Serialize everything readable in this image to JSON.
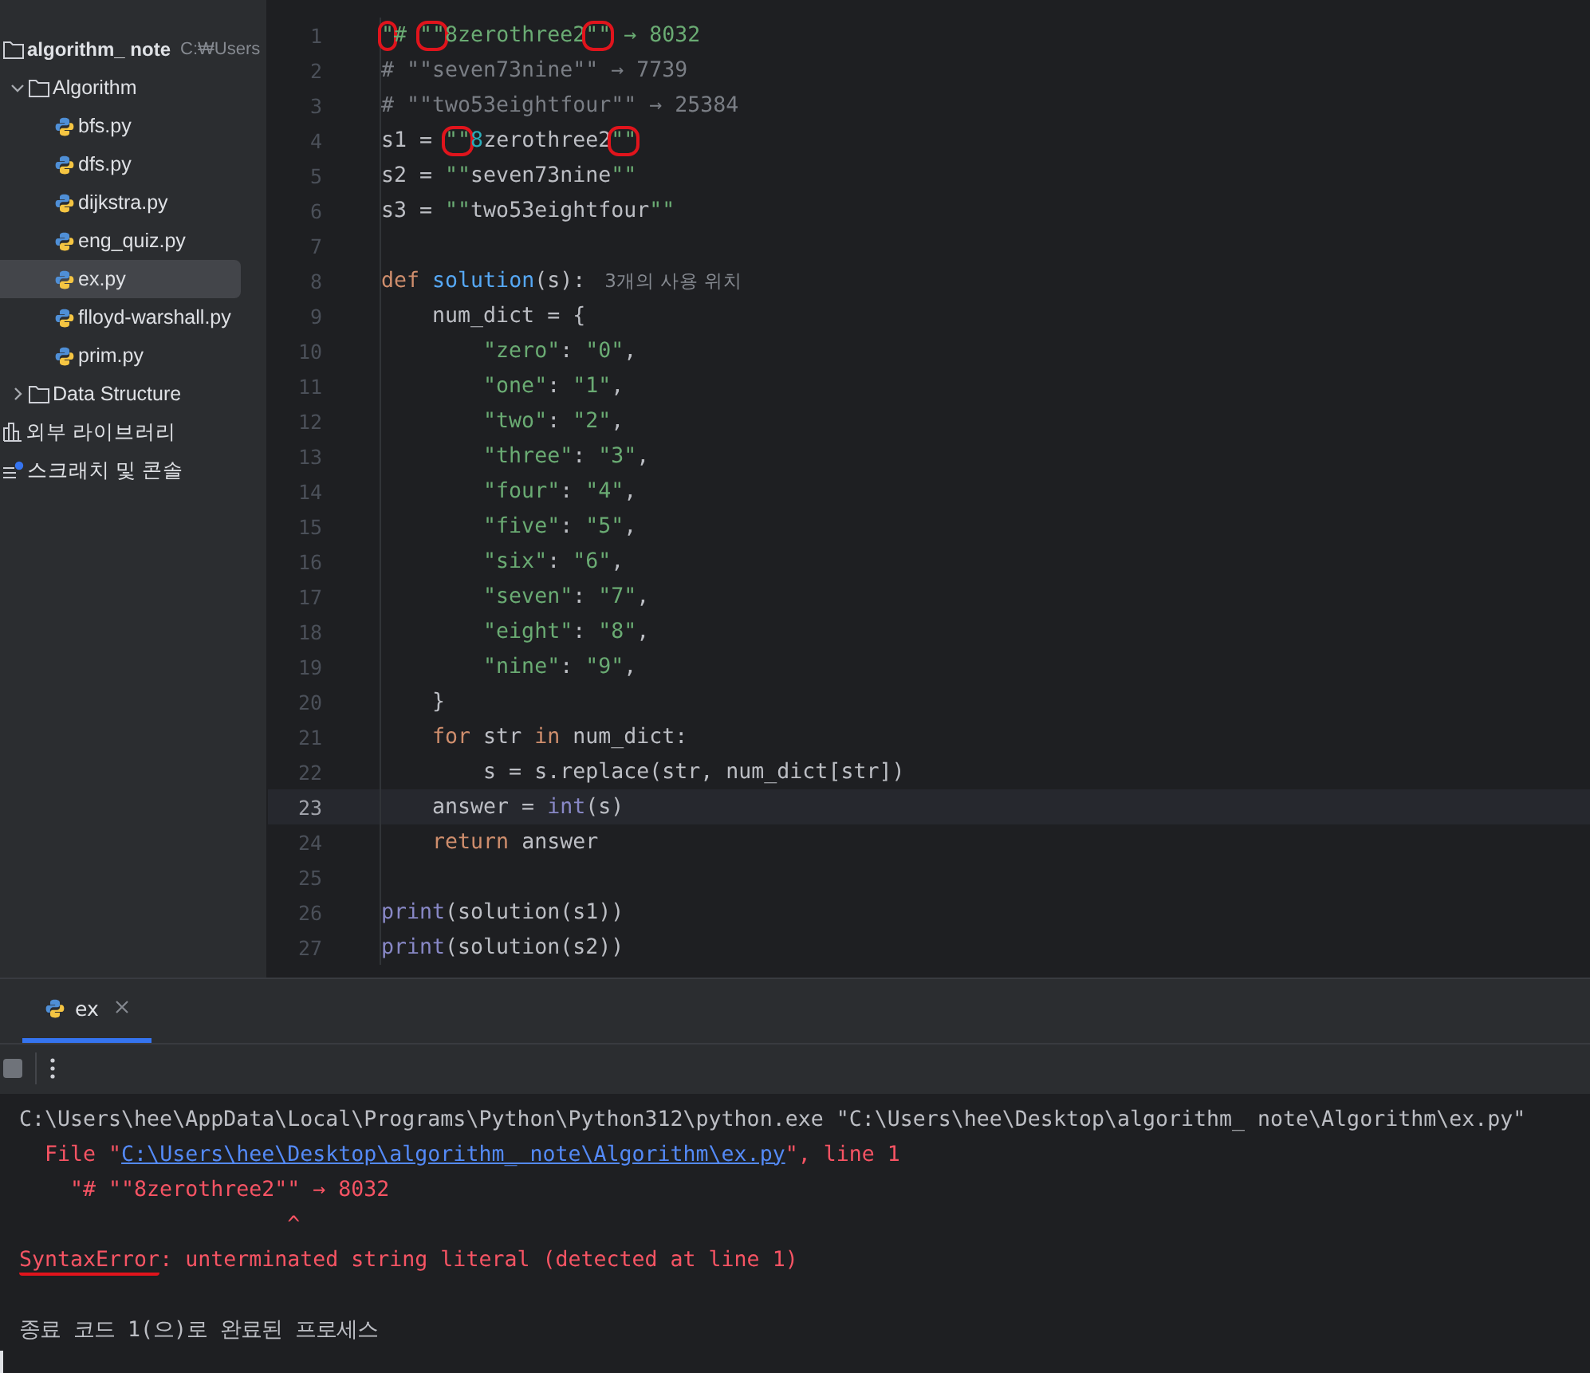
{
  "project_tree": [
    {
      "kind": "project",
      "label": "algorithm_ note",
      "hint": "C:₩Users",
      "selected": false
    },
    {
      "kind": "folder",
      "label": "Algorithm",
      "expanded": true,
      "selected": false,
      "children": [
        {
          "kind": "file",
          "label": "bfs.py",
          "selected": false
        },
        {
          "kind": "file",
          "label": "dfs.py",
          "selected": false
        },
        {
          "kind": "file",
          "label": "dijkstra.py",
          "selected": false
        },
        {
          "kind": "file",
          "label": "eng_quiz.py",
          "selected": false
        },
        {
          "kind": "file",
          "label": "ex.py",
          "selected": true
        },
        {
          "kind": "file",
          "label": "flloyd-warshall.py",
          "selected": false
        },
        {
          "kind": "file",
          "label": "prim.py",
          "selected": false
        }
      ]
    },
    {
      "kind": "folder",
      "label": "Data Structure",
      "expanded": false,
      "selected": false
    },
    {
      "kind": "library",
      "label": "외부 라이브러리",
      "selected": false
    },
    {
      "kind": "scratch",
      "label": "스크래치 및 콘솔",
      "selected": false
    }
  ],
  "editor": {
    "lines": [
      {
        "number": "1",
        "current": false,
        "tokens": [
          {
            "kind": "string",
            "text": "\"",
            "circled": true
          },
          {
            "kind": "string",
            "text": "# "
          },
          {
            "kind": "string",
            "text": "\"\"",
            "circled": true
          },
          {
            "kind": "string",
            "text": "8zerothree2"
          },
          {
            "kind": "string",
            "text": "\"\"",
            "circled": true
          },
          {
            "kind": "string",
            "text": " → 8032"
          }
        ]
      },
      {
        "number": "2",
        "current": false,
        "tokens": [
          {
            "kind": "comment",
            "text": "# \"\"seven73nine\"\" → 7739"
          }
        ]
      },
      {
        "number": "3",
        "current": false,
        "tokens": [
          {
            "kind": "comment",
            "text": "# \"\"two53eightfour\"\" → 25384"
          }
        ]
      },
      {
        "number": "4",
        "current": false,
        "tokens": [
          {
            "kind": "plain",
            "text": "s1 = "
          },
          {
            "kind": "string",
            "text": "\"\"",
            "circled": true
          },
          {
            "kind": "number",
            "text": "8"
          },
          {
            "kind": "plain",
            "text": "zerothree2"
          },
          {
            "kind": "string",
            "text": "\"\"",
            "circled": true
          }
        ]
      },
      {
        "number": "5",
        "current": false,
        "tokens": [
          {
            "kind": "plain",
            "text": "s2 = "
          },
          {
            "kind": "string",
            "text": "\"\""
          },
          {
            "kind": "plain",
            "text": "seven73nine"
          },
          {
            "kind": "string",
            "text": "\"\""
          }
        ]
      },
      {
        "number": "6",
        "current": false,
        "tokens": [
          {
            "kind": "plain",
            "text": "s3 = "
          },
          {
            "kind": "string",
            "text": "\"\""
          },
          {
            "kind": "plain",
            "text": "two53eightfour"
          },
          {
            "kind": "string",
            "text": "\"\""
          }
        ]
      },
      {
        "number": "7",
        "current": false
      },
      {
        "number": "8",
        "current": false,
        "tokens": [
          {
            "kind": "keyword",
            "text": "def "
          },
          {
            "kind": "function",
            "text": "solution"
          },
          {
            "kind": "plain",
            "text": "(s):"
          },
          {
            "kind": "hint",
            "text": "3개의 사용 위치"
          }
        ]
      },
      {
        "number": "9",
        "current": false,
        "tokens": [
          {
            "kind": "plain",
            "text": "    num_dict = {"
          }
        ]
      },
      {
        "number": "10",
        "current": false,
        "tokens": [
          {
            "kind": "string",
            "text": "        \"zero\""
          },
          {
            "kind": "plain",
            "text": ": "
          },
          {
            "kind": "string",
            "text": "\"0\""
          },
          {
            "kind": "plain",
            "text": ","
          }
        ]
      },
      {
        "number": "11",
        "current": false,
        "tokens": [
          {
            "kind": "string",
            "text": "        \"one\""
          },
          {
            "kind": "plain",
            "text": ": "
          },
          {
            "kind": "string",
            "text": "\"1\""
          },
          {
            "kind": "plain",
            "text": ","
          }
        ]
      },
      {
        "number": "12",
        "current": false,
        "tokens": [
          {
            "kind": "string",
            "text": "        \"two\""
          },
          {
            "kind": "plain",
            "text": ": "
          },
          {
            "kind": "string",
            "text": "\"2\""
          },
          {
            "kind": "plain",
            "text": ","
          }
        ]
      },
      {
        "number": "13",
        "current": false,
        "tokens": [
          {
            "kind": "string",
            "text": "        \"three\""
          },
          {
            "kind": "plain",
            "text": ": "
          },
          {
            "kind": "string",
            "text": "\"3\""
          },
          {
            "kind": "plain",
            "text": ","
          }
        ]
      },
      {
        "number": "14",
        "current": false,
        "tokens": [
          {
            "kind": "string",
            "text": "        \"four\""
          },
          {
            "kind": "plain",
            "text": ": "
          },
          {
            "kind": "string",
            "text": "\"4\""
          },
          {
            "kind": "plain",
            "text": ","
          }
        ]
      },
      {
        "number": "15",
        "current": false,
        "tokens": [
          {
            "kind": "string",
            "text": "        \"five\""
          },
          {
            "kind": "plain",
            "text": ": "
          },
          {
            "kind": "string",
            "text": "\"5\""
          },
          {
            "kind": "plain",
            "text": ","
          }
        ]
      },
      {
        "number": "16",
        "current": false,
        "tokens": [
          {
            "kind": "string",
            "text": "        \"six\""
          },
          {
            "kind": "plain",
            "text": ": "
          },
          {
            "kind": "string",
            "text": "\"6\""
          },
          {
            "kind": "plain",
            "text": ","
          }
        ]
      },
      {
        "number": "17",
        "current": false,
        "tokens": [
          {
            "kind": "string",
            "text": "        \"seven\""
          },
          {
            "kind": "plain",
            "text": ": "
          },
          {
            "kind": "string",
            "text": "\"7\""
          },
          {
            "kind": "plain",
            "text": ","
          }
        ]
      },
      {
        "number": "18",
        "current": false,
        "tokens": [
          {
            "kind": "string",
            "text": "        \"eight\""
          },
          {
            "kind": "plain",
            "text": ": "
          },
          {
            "kind": "string",
            "text": "\"8\""
          },
          {
            "kind": "plain",
            "text": ","
          }
        ]
      },
      {
        "number": "19",
        "current": false,
        "tokens": [
          {
            "kind": "string",
            "text": "        \"nine\""
          },
          {
            "kind": "plain",
            "text": ": "
          },
          {
            "kind": "string",
            "text": "\"9\""
          },
          {
            "kind": "plain",
            "text": ","
          }
        ]
      },
      {
        "number": "20",
        "current": false,
        "tokens": [
          {
            "kind": "plain",
            "text": "    }"
          }
        ]
      },
      {
        "number": "21",
        "current": false,
        "tokens": [
          {
            "kind": "keyword",
            "text": "    for"
          },
          {
            "kind": "plain",
            "text": " str "
          },
          {
            "kind": "keyword",
            "text": "in"
          },
          {
            "kind": "plain",
            "text": " num_dict:"
          }
        ]
      },
      {
        "number": "22",
        "current": false,
        "tokens": [
          {
            "kind": "plain",
            "text": "        s = s.replace(str, num_dict[str])"
          }
        ]
      },
      {
        "number": "23",
        "current": true,
        "tokens": [
          {
            "kind": "plain",
            "text": "    answer = "
          },
          {
            "kind": "builtin",
            "text": "int"
          },
          {
            "kind": "plain",
            "text": "(s)"
          }
        ]
      },
      {
        "number": "24",
        "current": false,
        "tokens": [
          {
            "kind": "keyword",
            "text": "    return"
          },
          {
            "kind": "plain",
            "text": " answer"
          }
        ]
      },
      {
        "number": "25",
        "current": false
      },
      {
        "number": "26",
        "current": false,
        "tokens": [
          {
            "kind": "builtin",
            "text": "print"
          },
          {
            "kind": "plain",
            "text": "(solution(s1))"
          }
        ]
      },
      {
        "number": "27",
        "current": false,
        "tokens": [
          {
            "kind": "builtin",
            "text": "print"
          },
          {
            "kind": "plain",
            "text": "(solution(s2))"
          }
        ]
      }
    ]
  },
  "run_panel": {
    "tabs": [
      {
        "label": "ex",
        "selected": true
      }
    ],
    "console": [
      {
        "segments": [
          {
            "kind": "output",
            "text": "C:\\Users\\hee\\AppData\\Local\\Programs\\Python\\Python312\\python.exe \"C:\\Users\\hee\\Desktop\\algorithm_ note\\Algorithm\\ex.py\""
          }
        ]
      },
      {
        "segments": [
          {
            "kind": "error",
            "text": "  File \""
          },
          {
            "kind": "link",
            "text": "C:\\Users\\hee\\Desktop\\algorithm_ note\\Algorithm\\ex.py"
          },
          {
            "kind": "error",
            "text": "\", line 1"
          }
        ]
      },
      {
        "segments": [
          {
            "kind": "error",
            "text": "    \"# \"\"8zerothree2\"\" → 8032"
          }
        ]
      },
      {
        "segments": [
          {
            "kind": "error",
            "text": "                     ^"
          }
        ]
      },
      {
        "segments": [
          {
            "kind": "error",
            "text": "SyntaxError",
            "underlined": true
          },
          {
            "kind": "error",
            "text": ": unterminated string literal (detected at line 1)"
          }
        ]
      },
      {
        "blank_line_before": true,
        "segments": [
          {
            "kind": "output",
            "text": "종료 코드 1(으)로 완료된 프로세스"
          }
        ]
      }
    ]
  }
}
